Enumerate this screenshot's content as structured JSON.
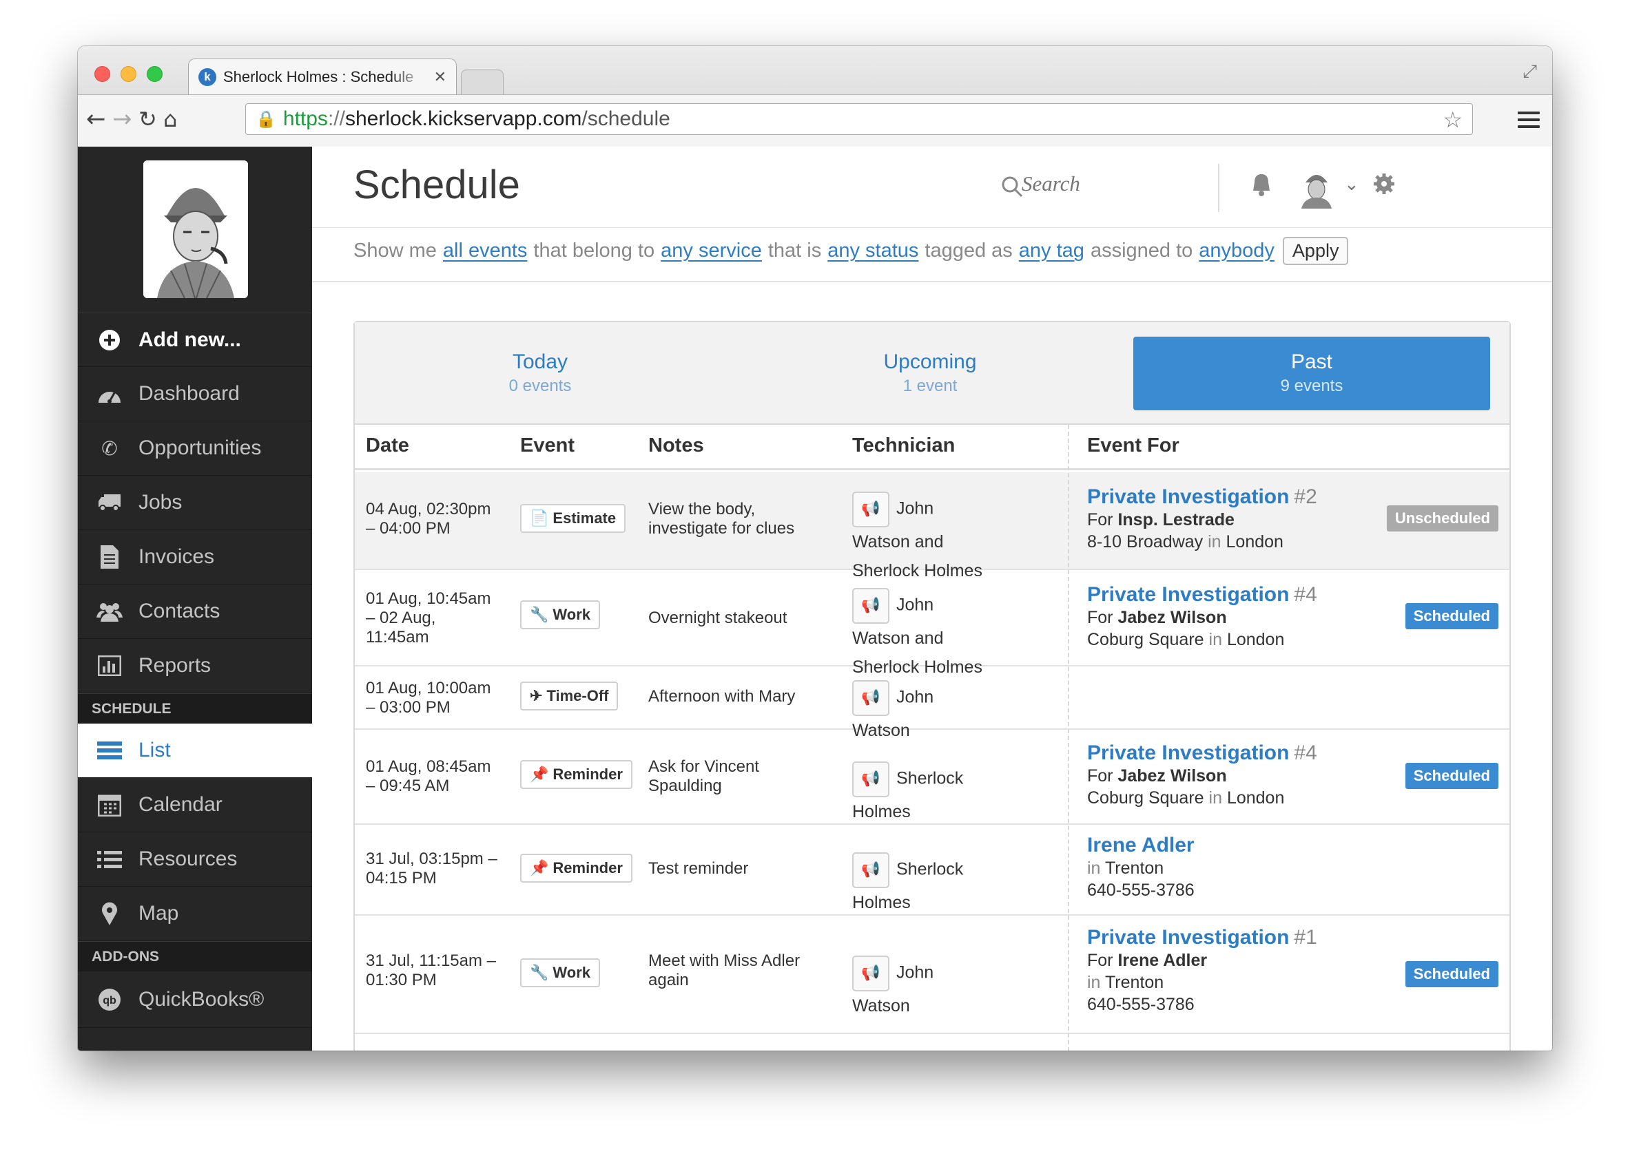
{
  "browser": {
    "tab_title": "Sherlock Holmes : Schedule",
    "favicon_letter": "k",
    "url_scheme": "https",
    "url_sep": "://",
    "url_host": "sherlock.kickservapp.com",
    "url_path": "/schedule"
  },
  "sidebar": {
    "add_new": "Add new...",
    "items": [
      {
        "label": "Dashboard",
        "icon": "dashboard-icon"
      },
      {
        "label": "Opportunities",
        "icon": "phone-icon"
      },
      {
        "label": "Jobs",
        "icon": "truck-icon"
      },
      {
        "label": "Invoices",
        "icon": "document-icon"
      },
      {
        "label": "Contacts",
        "icon": "people-icon"
      },
      {
        "label": "Reports",
        "icon": "bar-chart-icon"
      }
    ],
    "schedule_heading": "SCHEDULE",
    "schedule_items": [
      {
        "label": "List",
        "icon": "list-icon",
        "active": true
      },
      {
        "label": "Calendar",
        "icon": "calendar-icon"
      },
      {
        "label": "Resources",
        "icon": "resources-icon"
      },
      {
        "label": "Map",
        "icon": "map-pin-icon"
      }
    ],
    "addons_heading": "ADD-ONS",
    "addons_items": [
      {
        "label": "QuickBooks®",
        "icon": "quickbooks-icon"
      }
    ]
  },
  "header": {
    "title": "Schedule",
    "search_placeholder": "Search"
  },
  "filter": {
    "t1": "Show me",
    "events": "all events",
    "t2": "that belong to",
    "service": "any service",
    "t3": "that is",
    "status": "any status",
    "t4": "tagged as",
    "tag": "any tag",
    "t5": "assigned to",
    "assignee": "anybody",
    "apply": "Apply"
  },
  "tabs": [
    {
      "label": "Today",
      "count": "0 events"
    },
    {
      "label": "Upcoming",
      "count": "1 event"
    },
    {
      "label": "Past",
      "count": "9 events",
      "active": true
    }
  ],
  "columns": [
    "Date",
    "Event",
    "Notes",
    "Technician",
    "Event For"
  ],
  "rows": [
    {
      "date": [
        "04 Aug, 02:30pm",
        "– 04:00 PM"
      ],
      "event_icon": "📄",
      "event": "Estimate",
      "notes": [
        "View the body,",
        "investigate for clues"
      ],
      "tech": [
        "John Watson and",
        "Sherlock Holmes"
      ],
      "for_title": "Private Investigation",
      "for_num": "#2",
      "for_pre": "For ",
      "for_name": "Insp. Lestrade",
      "for_addr": "8-10 Broadway",
      "for_in": "in",
      "for_city": "London",
      "status": "Unscheduled"
    },
    {
      "date": [
        "01 Aug, 10:45am",
        "– 02 Aug,",
        "11:45am"
      ],
      "event_icon": "🔧",
      "event": "Work",
      "notes": [
        "Overnight stakeout"
      ],
      "tech": [
        "John Watson and",
        "Sherlock Holmes"
      ],
      "for_title": "Private Investigation",
      "for_num": "#4",
      "for_pre": "For ",
      "for_name": "Jabez Wilson",
      "for_addr": "Coburg Square",
      "for_in": "in",
      "for_city": "London",
      "status": "Scheduled"
    },
    {
      "date": [
        "01 Aug, 10:00am",
        "– 03:00 PM"
      ],
      "event_icon": "✈",
      "event": "Time-Off",
      "notes": [
        "Afternoon with Mary"
      ],
      "tech": [
        "John Watson"
      ]
    },
    {
      "date": [
        "01 Aug, 08:45am",
        "– 09:45 AM"
      ],
      "event_icon": "📌",
      "event": "Reminder",
      "notes": [
        "Ask for Vincent",
        "Spaulding"
      ],
      "tech": [
        "Sherlock Holmes"
      ],
      "for_title": "Private Investigation",
      "for_num": "#4",
      "for_pre": "For ",
      "for_name": "Jabez Wilson",
      "for_addr": "Coburg Square",
      "for_in": "in",
      "for_city": "London",
      "status": "Scheduled"
    },
    {
      "date": [
        "31 Jul, 03:15pm –",
        "04:15 PM"
      ],
      "event_icon": "📌",
      "event": "Reminder",
      "notes": [
        "Test reminder"
      ],
      "tech": [
        "Sherlock Holmes"
      ],
      "for_title": "Irene Adler",
      "for_in": "in",
      "for_city": "Trenton",
      "for_phone": "640-555-3786"
    },
    {
      "date": [
        "31 Jul, 11:15am –",
        "01:30 PM"
      ],
      "event_icon": "🔧",
      "event": "Work",
      "notes": [
        "Meet with Miss Adler",
        "again"
      ],
      "tech": [
        "John Watson"
      ],
      "for_title": "Private Investigation",
      "for_num": "#1",
      "for_pre": "For ",
      "for_name": "Irene Adler",
      "for_in": "in",
      "for_city": "Trenton",
      "for_phone": "640-555-3786",
      "status": "Scheduled"
    }
  ]
}
